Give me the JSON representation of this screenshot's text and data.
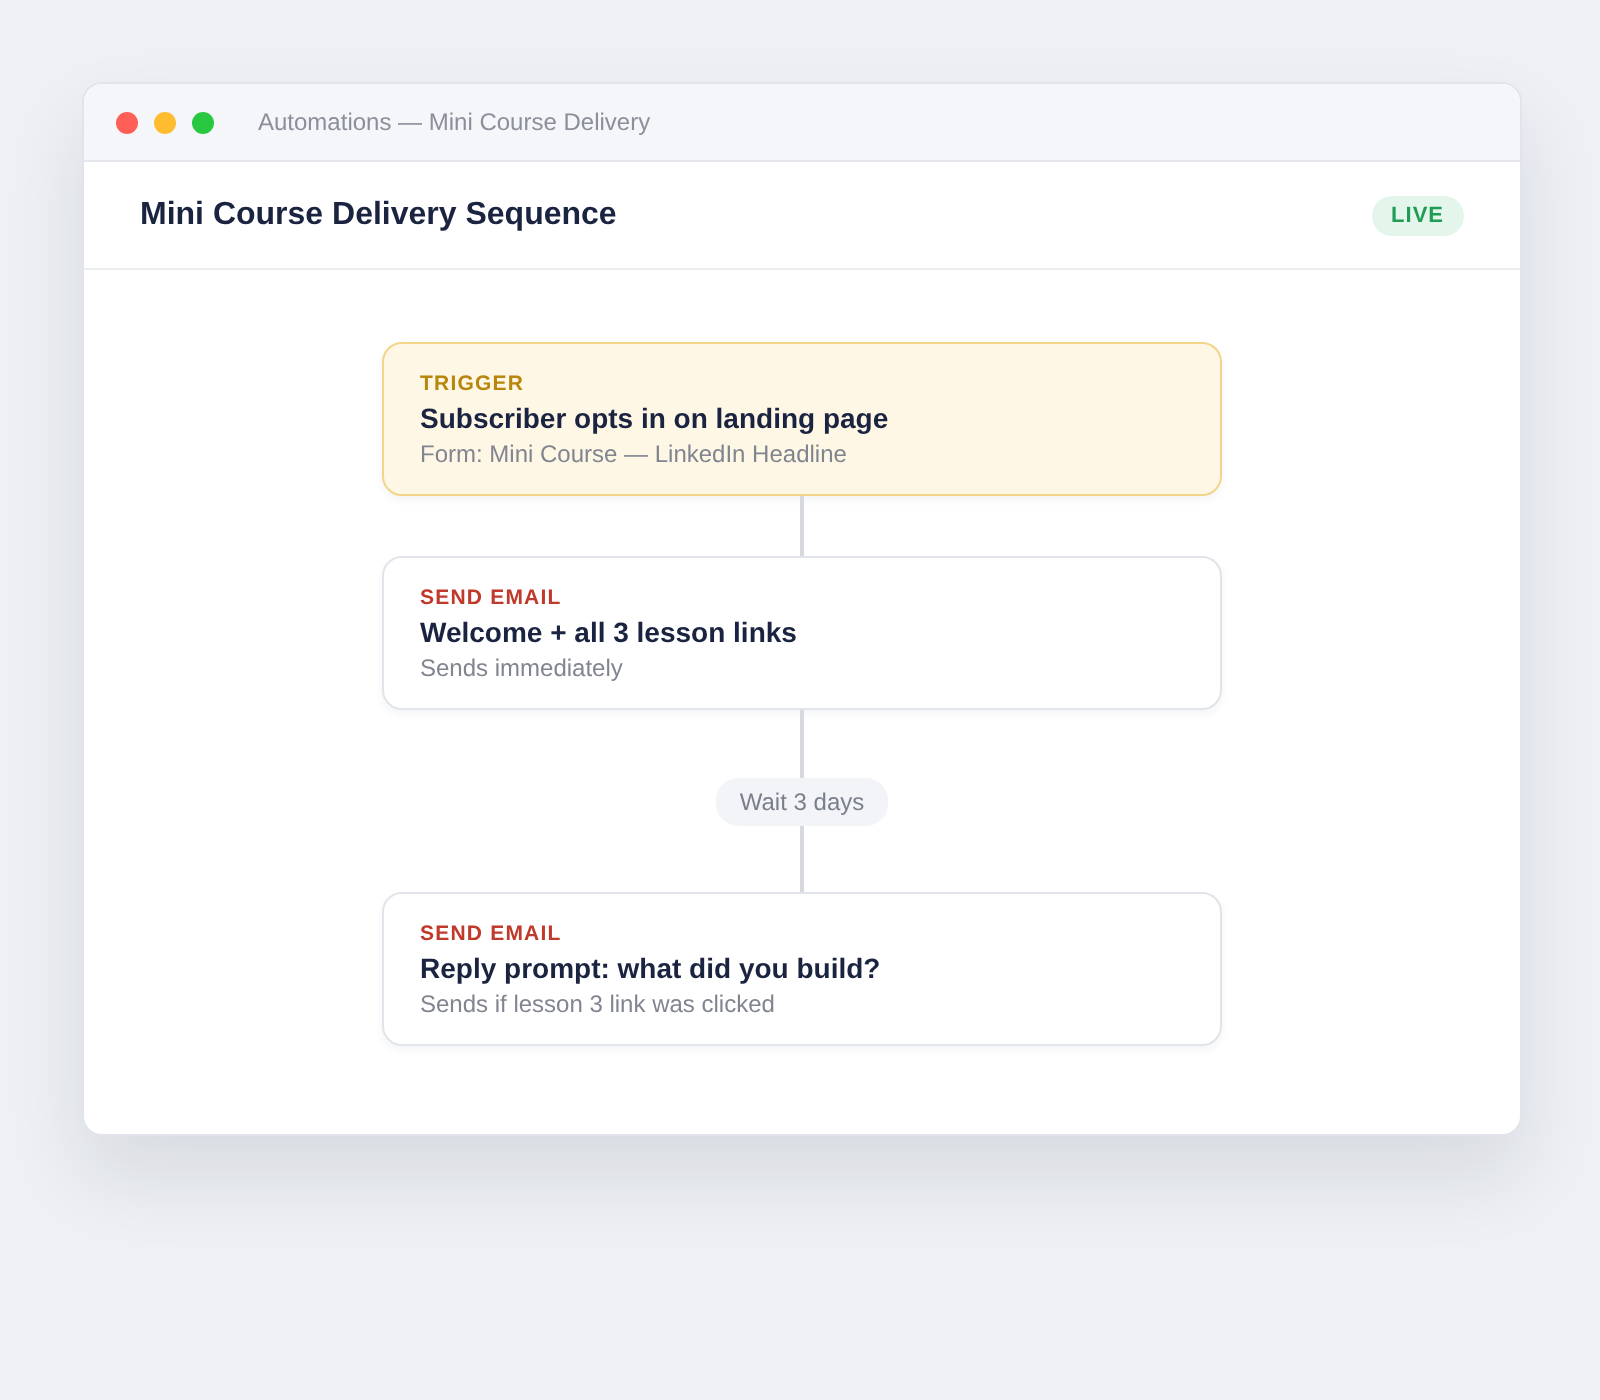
{
  "window": {
    "title": "Automations — Mini Course Delivery"
  },
  "header": {
    "title": "Mini Course Delivery Sequence",
    "status": "LIVE"
  },
  "steps": [
    {
      "kind": "trigger",
      "label": "TRIGGER",
      "title": "Subscriber opts in on landing page",
      "detail": "Form: Mini Course — LinkedIn Headline"
    },
    {
      "kind": "email",
      "label": "SEND EMAIL",
      "title": "Welcome + all 3 lesson links",
      "detail": "Sends immediately"
    },
    {
      "kind": "wait",
      "label": "Wait 3 days"
    },
    {
      "kind": "email",
      "label": "SEND EMAIL",
      "title": "Reply prompt: what did you build?",
      "detail": "Sends if lesson 3 link was clicked"
    }
  ]
}
